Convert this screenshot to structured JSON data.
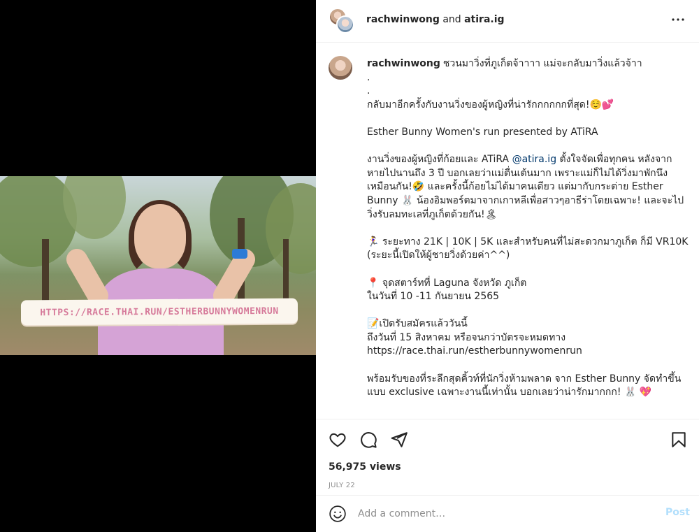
{
  "header": {
    "user1": "rachwinwong",
    "joiner": "and",
    "user2": "atira.ig"
  },
  "media": {
    "banner_url": "HTTPS://RACE.THAI.RUN/ESTHERBUNNYWOMENRUN"
  },
  "caption": {
    "username": "rachwinwong",
    "first_line": "ชวนมาวิ่งที่ภูเก็ตจ้าาาา แม่จะกลับมาวิ่งแล้วจ้าา",
    "dot1": ".",
    "dot2": ".",
    "line_return": "กลับมาอีกครั้งกับงานวิ่งของผู้หญิงที่น่ารักกกกกกที่สุด!☺️💕",
    "line_event": "Esther Bunny Women's run presented by ATiRA",
    "para1_before": "งานวิ่งของผู้หญิงที่ก้อยและ ATiRA ",
    "para1_mention": "@atira.ig",
    "para1_after": " ตั้งใจจัดเพื่อทุกคน หลังจากหายไปนานถึง 3 ปี บอกเลยว่าแม่ตื่นเต้นมาก เพราะแม่ก็ไม่ได้วิ่งมาพักนึงเหมือนกัน!🤣 และครั้งนี้ก้อยไม่ได้มาคนเดียว แต่มากับกระต่าย Esther Bunny 🐰 น้องอิมพอร์ตมาจากเกาหลีเพื่อสาวๆอาธีร่าโดยเฉพาะ! และจะไปวิ่งรับลมทะเลที่ภูเก็ตด้วยกัน!🏝",
    "para2": "🏃‍♀️ ระยะทาง 21K | 10K | 5K และสำหรับคนที่ไม่สะดวกมาภูเก็ต ก็มี VR10K (ระยะนี้เปิดให้ผู้ชายวิ่งด้วยค่า^^)",
    "para3_line1": "📍 จุดสตาร์ทที่ Laguna จังหวัด ภูเก็ต",
    "para3_line2": "ในวันที่ 10 -11 กันยายน 2565",
    "para4_line1": "📝เปิดรับสมัครแล้ววันนี้",
    "para4_line2": "ถึงวันที่ 15 สิงหาคม หรือจนกว่าบัตรจะหมดทาง",
    "para4_line3": "https://race.thai.run/estherbunnywomenrun",
    "para5": "พร้อมรับของที่ระลึกสุดคิ้วท์ที่นักวิ่งห้ามพลาด จาก Esther Bunny จัดทำขึ้นแบบ exclusive เฉพาะงานนี้เท่านั้น บอกเลยว่าน่ารักมากกก! 🐰 💖"
  },
  "actions": {
    "like_icon": "heart-icon",
    "comment_icon": "comment-icon",
    "share_icon": "send-icon",
    "save_icon": "bookmark-icon"
  },
  "stats": {
    "views": "56,975 views",
    "date": "JULY 22"
  },
  "comment_box": {
    "placeholder": "Add a comment…",
    "post_label": "Post"
  },
  "colors": {
    "mention": "#00376b",
    "post_disabled": "#b2dffc",
    "banner_text": "#d67a9a"
  }
}
